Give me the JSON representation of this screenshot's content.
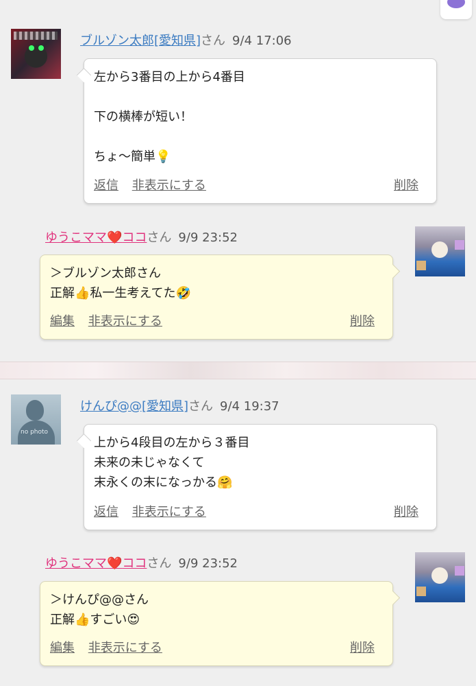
{
  "threads": [
    {
      "comment": {
        "user": "ブルゾン太郎[愛知県]",
        "honorific": "さん",
        "time": "9/4 17:06",
        "lines": [
          "左から3番目の上から4番目",
          "",
          "下の横棒が短い！",
          "",
          "ちょ〜簡単"
        ],
        "emoji": "💡",
        "actions": {
          "reply": "返信",
          "hide": "非表示にする",
          "delete": "削除"
        }
      },
      "reply": {
        "user_prefix": "ゆうこママ",
        "heart": "❤️",
        "user_suffix": "ココ",
        "honorific": "さん",
        "time": "9/9 23:52",
        "lines": [
          "＞ブルゾン太郎さん",
          "正解"
        ],
        "line2_mid": "私一生考えてた",
        "emoji_thumb": "👍",
        "emoji_end": "🤣",
        "actions": {
          "edit": "編集",
          "hide": "非表示にする",
          "delete": "削除"
        }
      }
    },
    {
      "comment": {
        "user": "けんぴ@@[愛知県]",
        "honorific": "さん",
        "time": "9/4 19:37",
        "lines": [
          "上から4段目の左から３番目",
          "未来の未じゃなくて",
          "末永くの末になっかる"
        ],
        "emoji": "🤗",
        "avatar_label": "no photo",
        "actions": {
          "reply": "返信",
          "hide": "非表示にする",
          "delete": "削除"
        }
      },
      "reply": {
        "user_prefix": "ゆうこママ",
        "heart": "❤️",
        "user_suffix": "ココ",
        "honorific": "さん",
        "time": "9/9 23:52",
        "lines": [
          "＞けんぴ@@さん",
          "正解"
        ],
        "line2_mid": "すごい",
        "emoji_thumb": "👍",
        "emoji_end": "😍",
        "actions": {
          "edit": "編集",
          "hide": "非表示にする",
          "delete": "削除"
        }
      }
    }
  ]
}
